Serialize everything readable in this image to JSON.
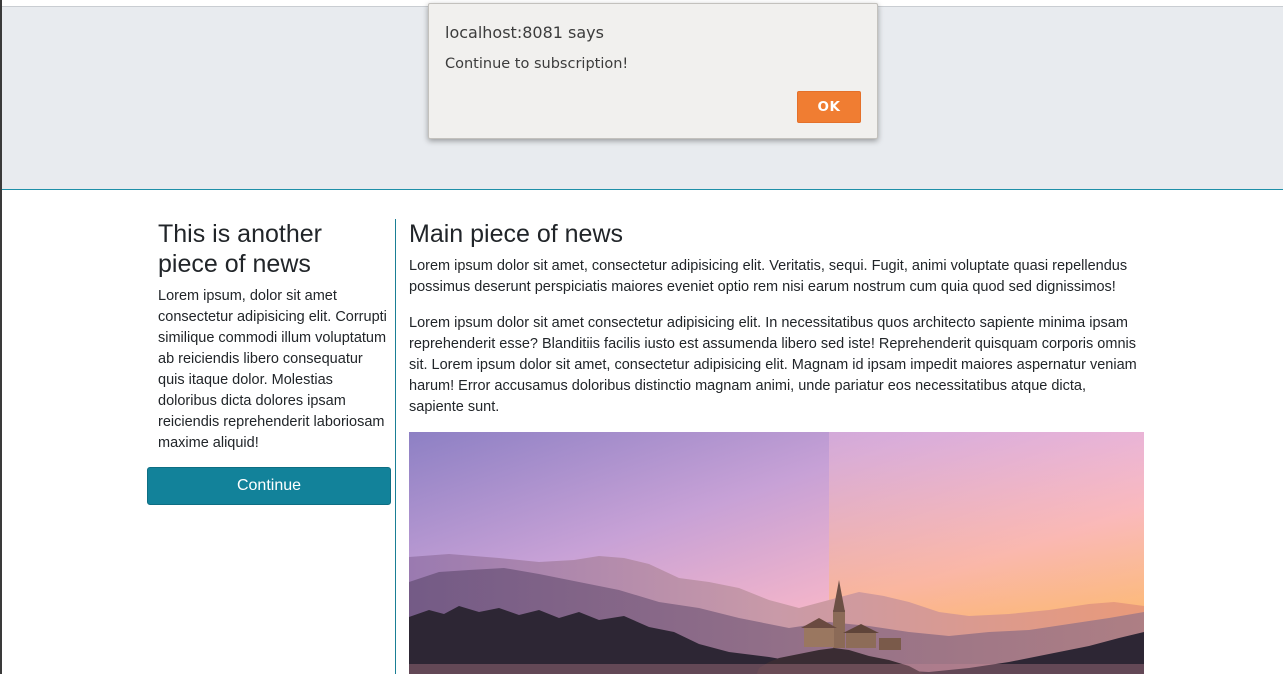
{
  "alert": {
    "origin": "localhost:8081 says",
    "message": "Continue to subscription!",
    "ok_label": "OK",
    "ok_color": "#f07d32"
  },
  "sidebar": {
    "title": "This is another piece of news",
    "text": "Lorem ipsum, dolor sit amet consectetur adipisicing elit. Corrupti similique commodi illum voluptatum ab reiciendis libero consequatur quis itaque dolor. Molestias doloribus dicta dolores ipsam reiciendis reprehenderit laboriosam maxime aliquid!",
    "button_label": "Continue",
    "button_color": "#12829a"
  },
  "main": {
    "title": "Main piece of news",
    "paragraphs": [
      "Lorem ipsum dolor sit amet, consectetur adipisicing elit. Veritatis, sequi. Fugit, animi voluptate quasi repellendus possimus deserunt perspiciatis maiores eveniet optio rem nisi earum nostrum cum quia quod sed dignissimos!",
      "Lorem ipsum dolor sit amet consectetur adipisicing elit. In necessitatibus quos architecto sapiente minima ipsam reprehenderit esse? Blanditiis facilis iusto est assumenda libero sed iste! Reprehenderit quisquam corporis omnis sit. Lorem ipsum dolor sit amet, consectetur adipisicing elit. Magnam id ipsam impedit maiores aspernatur veniam harum! Error accusamus doloribus distinctio magnam animi, unde pariatur eos necessitatibus atque dicta, sapiente sunt."
    ],
    "image_icon": "lake-church-sunset-image"
  }
}
